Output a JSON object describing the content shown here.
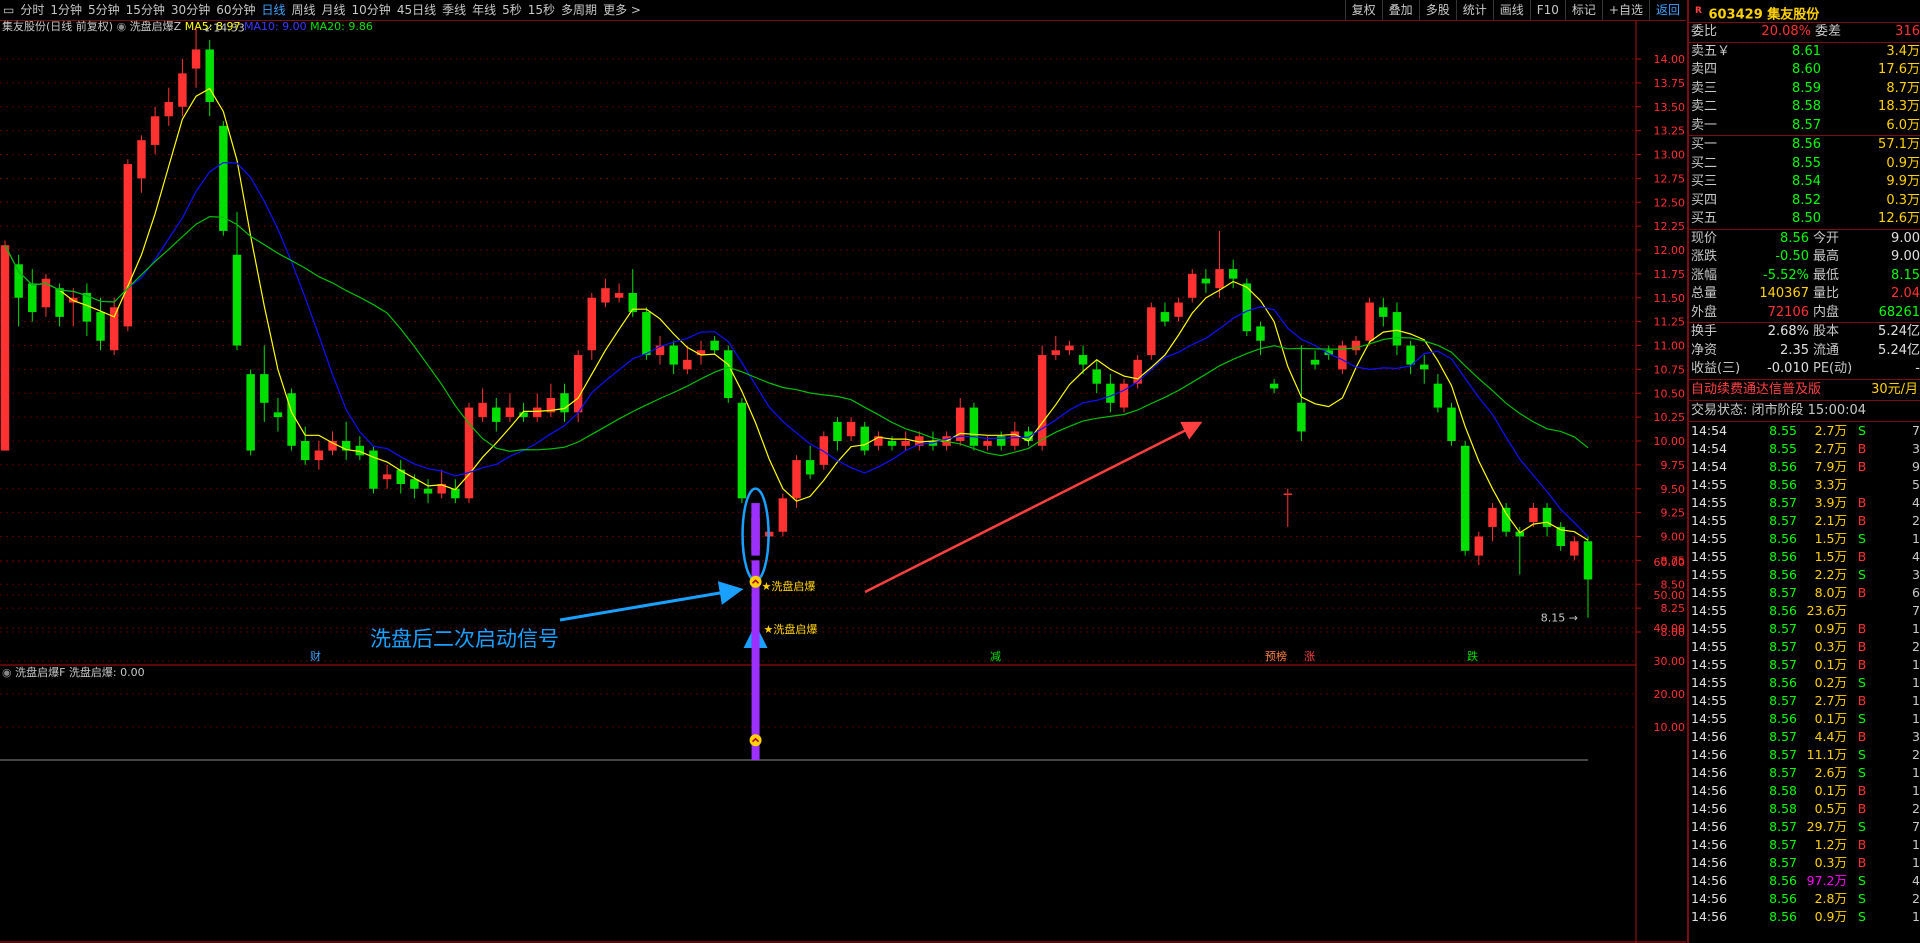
{
  "toolbar": {
    "periods": [
      "分时",
      "1分钟",
      "5分钟",
      "15分钟",
      "30分钟",
      "60分钟",
      "日线",
      "周线",
      "月线",
      "10分钟",
      "45日线",
      "季线",
      "年线",
      "5秒",
      "15秒",
      "多周期",
      "更多 >"
    ],
    "active_period": "日线",
    "right_tools": [
      "复权",
      "叠加",
      "多股",
      "统计",
      "画线",
      "F10",
      "标记",
      "+自选",
      "返回"
    ]
  },
  "main_chart": {
    "title": "集友股份(日线 前复权)",
    "indicator": "洗盘启爆Z",
    "ma5_label": "MA5: 8.97",
    "ma10_label": "MA10: 9.00",
    "ma20_label": "MA20: 9.86",
    "high_marker": "14.33",
    "low_marker": "8.15",
    "signal_label": "★洗盘启爆",
    "annotation_text": "洗盘后二次启动信号",
    "event_tags": [
      "财",
      "减",
      "预榜",
      "涨",
      "跌"
    ],
    "price_axis": [
      "14.00",
      "13.75",
      "13.50",
      "13.25",
      "13.00",
      "12.75",
      "12.50",
      "12.25",
      "12.00",
      "11.75",
      "11.50",
      "11.25",
      "11.00",
      "10.75",
      "10.50",
      "10.25",
      "10.00",
      "9.75",
      "9.50",
      "9.25",
      "9.00",
      "8.75",
      "8.50",
      "8.25",
      "8.00"
    ]
  },
  "sub_chart": {
    "title": "洗盘启爆F",
    "value_label": "洗盘启爆: 0.00",
    "signal_label": "★洗盘启爆",
    "axis": [
      "60.00",
      "50.00",
      "40.00",
      "30.00",
      "20.00",
      "10.00"
    ]
  },
  "colors": {
    "up": "#ff3232",
    "down": "#00e000",
    "ma5": "#ffff00",
    "ma10": "#1010ff",
    "ma20": "#00c000",
    "signal": "#9b30ff",
    "annotation": "#1aa0ff",
    "arrow": "#ff4040"
  },
  "candles": [
    [
      9.9,
      12.05,
      12.1,
      11.25
    ],
    [
      11.85,
      11.5,
      11.95,
      11.2
    ],
    [
      11.65,
      11.35,
      11.8,
      11.25
    ],
    [
      11.4,
      11.7,
      11.75,
      11.3
    ],
    [
      11.6,
      11.3,
      11.65,
      11.2
    ],
    [
      11.45,
      11.5,
      11.6,
      11.2
    ],
    [
      11.55,
      11.25,
      11.65,
      11.1
    ],
    [
      11.35,
      11.05,
      11.5,
      10.95
    ],
    [
      10.95,
      11.4,
      11.5,
      10.9
    ],
    [
      11.2,
      12.9,
      12.95,
      11.15
    ],
    [
      12.75,
      13.15,
      13.2,
      12.6
    ],
    [
      13.1,
      13.4,
      13.5,
      13.0
    ],
    [
      13.4,
      13.55,
      13.7,
      13.3
    ],
    [
      13.5,
      13.85,
      14.0,
      13.4
    ],
    [
      13.9,
      14.1,
      14.33,
      13.7
    ],
    [
      14.1,
      13.55,
      14.2,
      13.4
    ],
    [
      13.3,
      12.2,
      13.35,
      12.15
    ],
    [
      11.95,
      11.0,
      12.4,
      10.95
    ],
    [
      10.7,
      9.9,
      10.75,
      9.85
    ],
    [
      10.7,
      10.4,
      11.0,
      10.2
    ],
    [
      10.3,
      10.25,
      10.45,
      10.1
    ],
    [
      10.5,
      9.95,
      10.55,
      9.9
    ],
    [
      10.0,
      9.8,
      10.15,
      9.75
    ],
    [
      9.8,
      9.9,
      10.0,
      9.7
    ],
    [
      9.9,
      10.0,
      10.1,
      9.85
    ],
    [
      10.0,
      9.9,
      10.2,
      9.8
    ],
    [
      9.95,
      9.85,
      10.05,
      9.8
    ],
    [
      9.9,
      9.5,
      9.95,
      9.45
    ],
    [
      9.6,
      9.65,
      9.75,
      9.5
    ],
    [
      9.7,
      9.55,
      9.8,
      9.45
    ],
    [
      9.6,
      9.5,
      9.65,
      9.4
    ],
    [
      9.5,
      9.45,
      9.6,
      9.35
    ],
    [
      9.45,
      9.55,
      9.7,
      9.4
    ],
    [
      9.5,
      9.4,
      9.6,
      9.35
    ],
    [
      9.4,
      10.35,
      10.4,
      9.35
    ],
    [
      10.25,
      10.4,
      10.55,
      10.2
    ],
    [
      10.35,
      10.2,
      10.45,
      10.1
    ],
    [
      10.25,
      10.35,
      10.5,
      10.2
    ],
    [
      10.3,
      10.25,
      10.4,
      10.2
    ],
    [
      10.25,
      10.35,
      10.5,
      10.2
    ],
    [
      10.3,
      10.45,
      10.6,
      10.25
    ],
    [
      10.5,
      10.3,
      10.6,
      10.2
    ],
    [
      10.3,
      10.9,
      10.95,
      10.2
    ],
    [
      10.95,
      11.5,
      11.55,
      10.85
    ],
    [
      11.45,
      11.6,
      11.7,
      11.4
    ],
    [
      11.5,
      11.55,
      11.65,
      11.45
    ],
    [
      11.55,
      11.35,
      11.8,
      11.3
    ],
    [
      11.35,
      10.9,
      11.4,
      10.85
    ],
    [
      10.9,
      11.0,
      11.1,
      10.8
    ],
    [
      11.0,
      10.8,
      11.05,
      10.7
    ],
    [
      10.75,
      10.85,
      11.0,
      10.7
    ],
    [
      10.9,
      10.95,
      11.05,
      10.8
    ],
    [
      11.05,
      10.95,
      11.1,
      10.9
    ],
    [
      10.95,
      10.45,
      11.0,
      10.4
    ],
    [
      10.4,
      9.4,
      10.45,
      9.35
    ],
    [
      8.85,
      9.2,
      9.25,
      8.85
    ],
    [
      9.0,
      9.05,
      9.1,
      8.95
    ],
    [
      9.05,
      9.4,
      9.45,
      9.0
    ],
    [
      9.4,
      9.8,
      9.85,
      9.3
    ],
    [
      9.8,
      9.65,
      9.95,
      9.6
    ],
    [
      9.75,
      10.05,
      10.1,
      9.7
    ],
    [
      10.2,
      10.0,
      10.25,
      9.9
    ],
    [
      10.05,
      10.2,
      10.25,
      10.0
    ],
    [
      10.15,
      9.9,
      10.2,
      9.85
    ],
    [
      9.95,
      10.05,
      10.1,
      9.9
    ],
    [
      10.0,
      9.95,
      10.05,
      9.9
    ],
    [
      9.95,
      10.0,
      10.1,
      9.9
    ],
    [
      9.95,
      10.05,
      10.1,
      9.9
    ],
    [
      10.0,
      9.95,
      10.1,
      9.9
    ],
    [
      9.95,
      10.05,
      10.1,
      9.9
    ],
    [
      10.0,
      10.35,
      10.45,
      9.95
    ],
    [
      10.35,
      9.95,
      10.4,
      9.9
    ],
    [
      9.95,
      10.0,
      10.05,
      9.9
    ],
    [
      10.05,
      9.95,
      10.1,
      9.9
    ],
    [
      9.95,
      10.1,
      10.2,
      9.9
    ],
    [
      10.1,
      10.0,
      10.15,
      9.95
    ],
    [
      9.95,
      10.9,
      11.0,
      9.9
    ],
    [
      10.9,
      10.95,
      11.1,
      10.85
    ],
    [
      10.95,
      11.0,
      11.05,
      10.9
    ],
    [
      10.9,
      10.8,
      11.0,
      10.7
    ],
    [
      10.75,
      10.6,
      10.85,
      10.5
    ],
    [
      10.6,
      10.4,
      10.7,
      10.3
    ],
    [
      10.35,
      10.6,
      10.65,
      10.3
    ],
    [
      10.6,
      10.85,
      10.9,
      10.55
    ],
    [
      10.9,
      11.4,
      11.45,
      10.85
    ],
    [
      11.35,
      11.25,
      11.45,
      11.2
    ],
    [
      11.3,
      11.45,
      11.5,
      11.25
    ],
    [
      11.5,
      11.75,
      11.8,
      11.45
    ],
    [
      11.7,
      11.65,
      11.8,
      11.55
    ],
    [
      11.6,
      11.8,
      12.2,
      11.5
    ],
    [
      11.8,
      11.7,
      11.9,
      11.6
    ],
    [
      11.65,
      11.15,
      11.7,
      11.1
    ],
    [
      11.2,
      11.05,
      11.25,
      10.9
    ],
    [
      10.6,
      10.55,
      10.65,
      10.5
    ],
    [
      9.45,
      9.45,
      9.5,
      9.1
    ],
    [
      10.4,
      10.1,
      11.0,
      10.0
    ],
    [
      10.85,
      10.8,
      10.95,
      10.75
    ],
    [
      10.95,
      10.9,
      11.0,
      10.85
    ],
    [
      10.75,
      11.0,
      11.05,
      10.7
    ],
    [
      10.95,
      11.05,
      11.1,
      10.9
    ],
    [
      11.05,
      11.45,
      11.5,
      11.0
    ],
    [
      11.4,
      11.3,
      11.5,
      11.2
    ],
    [
      11.35,
      11.0,
      11.45,
      10.9
    ],
    [
      11.0,
      10.8,
      11.05,
      10.7
    ],
    [
      10.8,
      10.75,
      10.9,
      10.6
    ],
    [
      10.6,
      10.35,
      10.7,
      10.3
    ],
    [
      10.35,
      10.0,
      10.4,
      9.95
    ],
    [
      9.95,
      8.85,
      10.0,
      8.8
    ],
    [
      8.8,
      9.0,
      9.05,
      8.7
    ],
    [
      9.1,
      9.3,
      9.35,
      8.95
    ],
    [
      9.3,
      9.05,
      9.35,
      9.0
    ],
    [
      9.05,
      9.0,
      9.1,
      8.6
    ],
    [
      9.15,
      9.3,
      9.35,
      9.1
    ],
    [
      9.3,
      9.1,
      9.35,
      9.0
    ],
    [
      9.1,
      8.9,
      9.15,
      8.85
    ],
    [
      8.8,
      8.95,
      9.0,
      8.75
    ],
    [
      8.95,
      8.55,
      9.0,
      8.15
    ]
  ],
  "right_panel": {
    "stock_code": "603429",
    "stock_name": "集友股份",
    "r_badge": "R",
    "weibi_label": "委比",
    "weibi_value": "20.08%",
    "weicha_label": "委差",
    "weicha_value": "316",
    "asks": [
      {
        "label": "卖五￥",
        "price": "8.61",
        "vol": "3.4万"
      },
      {
        "label": "卖四",
        "price": "8.60",
        "vol": "17.6万"
      },
      {
        "label": "卖三",
        "price": "8.59",
        "vol": "8.7万"
      },
      {
        "label": "卖二",
        "price": "8.58",
        "vol": "18.3万"
      },
      {
        "label": "卖一",
        "price": "8.57",
        "vol": "6.0万"
      }
    ],
    "bids": [
      {
        "label": "买一",
        "price": "8.56",
        "vol": "57.1万"
      },
      {
        "label": "买二",
        "price": "8.55",
        "vol": "0.9万"
      },
      {
        "label": "买三",
        "price": "8.54",
        "vol": "9.9万"
      },
      {
        "label": "买四",
        "price": "8.52",
        "vol": "0.3万"
      },
      {
        "label": "买五",
        "price": "8.50",
        "vol": "12.6万"
      }
    ],
    "stats": [
      {
        "a": "现价",
        "b": "8.56",
        "c": "今开",
        "d": "9.00",
        "bc": "g",
        "dc": "w"
      },
      {
        "a": "涨跌",
        "b": "-0.50",
        "c": "最高",
        "d": "9.00",
        "bc": "g",
        "dc": "w"
      },
      {
        "a": "涨幅",
        "b": "-5.52%",
        "c": "最低",
        "d": "8.15",
        "bc": "g",
        "dc": "g"
      },
      {
        "a": "总量",
        "b": "140367",
        "c": "量比",
        "d": "2.04",
        "bc": "y",
        "dc": "rd"
      },
      {
        "a": "外盘",
        "b": "72106",
        "c": "内盘",
        "d": "68261",
        "bc": "rd",
        "dc": "g"
      }
    ],
    "stats2": [
      {
        "a": "换手",
        "b": "2.68%",
        "c": "股本",
        "d": "5.24亿"
      },
      {
        "a": "净资",
        "b": "2.35",
        "c": "流通",
        "d": "5.24亿"
      },
      {
        "a": "收益(三)",
        "b": "-0.010",
        "c": "PE(动)",
        "d": "-"
      }
    ],
    "ad_text": "自动续费通达信普及版",
    "ad_price": "30元/月",
    "trade_status": "交易状态: 闭市阶段 15:00:04",
    "ticks": [
      [
        "14:54",
        "8.55",
        "2.7万",
        "S",
        "7"
      ],
      [
        "14:54",
        "8.55",
        "2.7万",
        "B",
        "3"
      ],
      [
        "14:54",
        "8.56",
        "7.9万",
        "B",
        "9"
      ],
      [
        "14:55",
        "8.56",
        "3.3万",
        "",
        "5"
      ],
      [
        "14:55",
        "8.57",
        "3.9万",
        "B",
        "4"
      ],
      [
        "14:55",
        "8.57",
        "2.1万",
        "B",
        "2"
      ],
      [
        "14:55",
        "8.56",
        "1.5万",
        "S",
        "1"
      ],
      [
        "14:55",
        "8.56",
        "1.5万",
        "B",
        "4"
      ],
      [
        "14:55",
        "8.56",
        "2.2万",
        "S",
        "3"
      ],
      [
        "14:55",
        "8.57",
        "8.0万",
        "B",
        "6"
      ],
      [
        "14:55",
        "8.56",
        "23.6万",
        "",
        "7"
      ],
      [
        "14:55",
        "8.57",
        "0.9万",
        "B",
        "1"
      ],
      [
        "14:55",
        "8.57",
        "0.3万",
        "B",
        "2"
      ],
      [
        "14:55",
        "8.57",
        "0.1万",
        "B",
        "1"
      ],
      [
        "14:55",
        "8.56",
        "0.2万",
        "S",
        "1"
      ],
      [
        "14:55",
        "8.57",
        "2.7万",
        "B",
        "1"
      ],
      [
        "14:55",
        "8.56",
        "0.1万",
        "S",
        "1"
      ],
      [
        "14:56",
        "8.57",
        "4.4万",
        "B",
        "3"
      ],
      [
        "14:56",
        "8.57",
        "11.1万",
        "S",
        "2"
      ],
      [
        "14:56",
        "8.57",
        "2.6万",
        "S",
        "1"
      ],
      [
        "14:56",
        "8.58",
        "0.1万",
        "B",
        "1"
      ],
      [
        "14:56",
        "8.58",
        "0.5万",
        "B",
        "2"
      ],
      [
        "14:56",
        "8.57",
        "29.7万",
        "S",
        "7"
      ],
      [
        "14:56",
        "8.57",
        "1.2万",
        "B",
        "1"
      ],
      [
        "14:56",
        "8.57",
        "0.3万",
        "B",
        "1"
      ],
      [
        "14:56",
        "8.56",
        "97.2万",
        "S",
        "4"
      ],
      [
        "14:56",
        "8.56",
        "2.8万",
        "S",
        "2"
      ],
      [
        "14:56",
        "8.56",
        "0.9万",
        "S",
        "1"
      ]
    ]
  }
}
